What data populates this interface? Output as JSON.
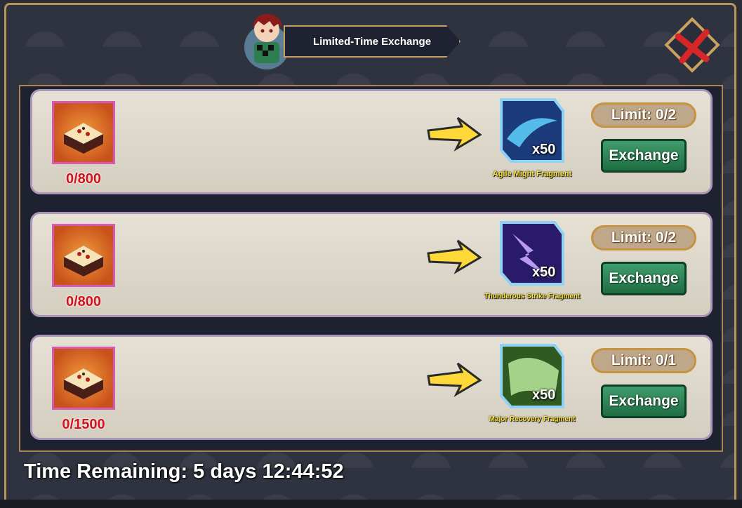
{
  "header": {
    "title": "Limited-Time Exchange"
  },
  "rows": [
    {
      "cost_count": "0/800",
      "reward_qty": "x50",
      "reward_name": "Agile Might Fragment",
      "limit": "Limit: 0/2",
      "button": "Exchange",
      "reward_color": "#3a8fd6"
    },
    {
      "cost_count": "0/800",
      "reward_qty": "x50",
      "reward_name": "Thunderous Strike Fragment",
      "limit": "Limit: 0/2",
      "button": "Exchange",
      "reward_color": "#7a4fd8"
    },
    {
      "cost_count": "0/1500",
      "reward_qty": "x50",
      "reward_name": "Major Recovery Fragment",
      "limit": "Limit: 0/1",
      "button": "Exchange",
      "reward_color": "#5fae4a"
    }
  ],
  "footer": {
    "time_remaining": "Time Remaining: 5 days 12:44:52"
  },
  "colors": {
    "accent_gold": "#b9955d",
    "exchange_green": "#2e8a58",
    "cost_red": "#d4101a"
  },
  "icons": {
    "close": "red-x-icon",
    "arrow": "yellow-arrow-icon",
    "cost_item": "cake-icon"
  }
}
